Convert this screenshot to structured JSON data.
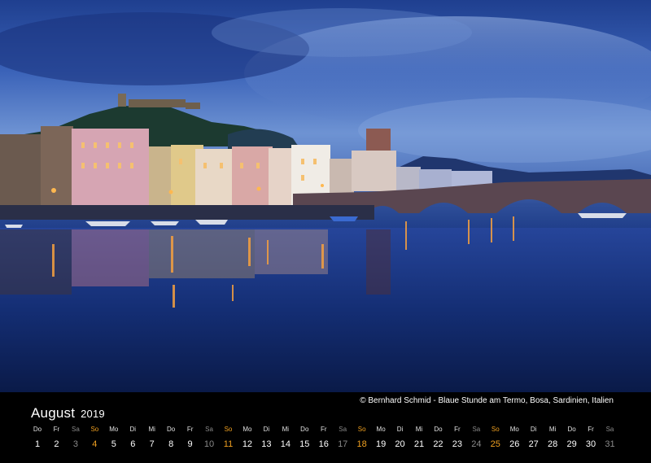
{
  "photo": {
    "subject": "river-town-blue-hour",
    "colors": {
      "sky": "#3a62b8",
      "water": "#0f2563",
      "lights": "#f5a040"
    }
  },
  "calendar": {
    "month": "August",
    "year": "2019",
    "caption": "© Bernhard Schmid - Blaue Stunde am Termo, Bosa, Sardinien, Italien",
    "days": [
      {
        "wd": "Do",
        "n": "1",
        "kind": "weekday"
      },
      {
        "wd": "Fr",
        "n": "2",
        "kind": "weekday"
      },
      {
        "wd": "Sa",
        "n": "3",
        "kind": "sat"
      },
      {
        "wd": "So",
        "n": "4",
        "kind": "sun"
      },
      {
        "wd": "Mo",
        "n": "5",
        "kind": "weekday"
      },
      {
        "wd": "Di",
        "n": "6",
        "kind": "weekday"
      },
      {
        "wd": "Mi",
        "n": "7",
        "kind": "weekday"
      },
      {
        "wd": "Do",
        "n": "8",
        "kind": "weekday"
      },
      {
        "wd": "Fr",
        "n": "9",
        "kind": "weekday"
      },
      {
        "wd": "Sa",
        "n": "10",
        "kind": "sat"
      },
      {
        "wd": "So",
        "n": "11",
        "kind": "sun"
      },
      {
        "wd": "Mo",
        "n": "12",
        "kind": "weekday"
      },
      {
        "wd": "Di",
        "n": "13",
        "kind": "weekday"
      },
      {
        "wd": "Mi",
        "n": "14",
        "kind": "weekday"
      },
      {
        "wd": "Do",
        "n": "15",
        "kind": "weekday"
      },
      {
        "wd": "Fr",
        "n": "16",
        "kind": "weekday"
      },
      {
        "wd": "Sa",
        "n": "17",
        "kind": "sat"
      },
      {
        "wd": "So",
        "n": "18",
        "kind": "sun"
      },
      {
        "wd": "Mo",
        "n": "19",
        "kind": "weekday"
      },
      {
        "wd": "Di",
        "n": "20",
        "kind": "weekday"
      },
      {
        "wd": "Mi",
        "n": "21",
        "kind": "weekday"
      },
      {
        "wd": "Do",
        "n": "22",
        "kind": "weekday"
      },
      {
        "wd": "Fr",
        "n": "23",
        "kind": "weekday"
      },
      {
        "wd": "Sa",
        "n": "24",
        "kind": "sat"
      },
      {
        "wd": "So",
        "n": "25",
        "kind": "sun"
      },
      {
        "wd": "Mo",
        "n": "26",
        "kind": "weekday"
      },
      {
        "wd": "Di",
        "n": "27",
        "kind": "weekday"
      },
      {
        "wd": "Mi",
        "n": "28",
        "kind": "weekday"
      },
      {
        "wd": "Do",
        "n": "29",
        "kind": "weekday"
      },
      {
        "wd": "Fr",
        "n": "30",
        "kind": "weekday"
      },
      {
        "wd": "Sa",
        "n": "31",
        "kind": "sat"
      }
    ],
    "colors": {
      "weekday": "#ffffff",
      "saturday": "#8a8a8a",
      "sunday": "#f0a020"
    }
  }
}
